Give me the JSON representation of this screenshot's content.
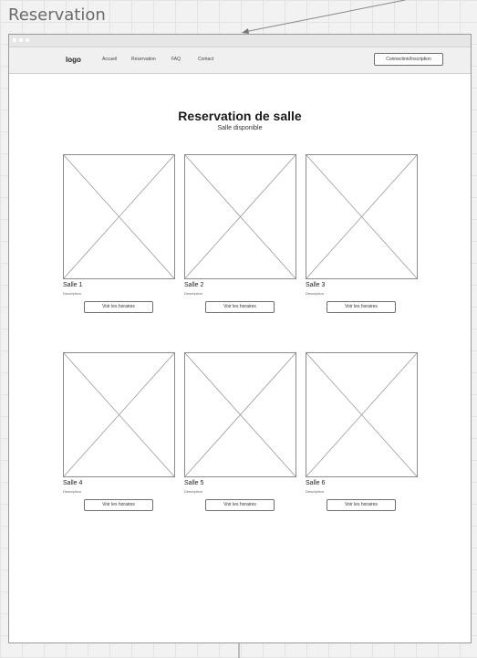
{
  "frame": {
    "title": "Reservation"
  },
  "navbar": {
    "logo": "logo",
    "links": [
      "Accueil",
      "Reservation",
      "FAQ",
      "Contact"
    ],
    "login_button": "Connection/Inscription"
  },
  "main": {
    "title": "Reservation de salle",
    "subtitle": "Salle disponible"
  },
  "rooms": [
    {
      "name": "Salle 1",
      "description": "Description",
      "button": "Voir les horaires"
    },
    {
      "name": "Salle 2",
      "description": "Description",
      "button": "Voir les horaires"
    },
    {
      "name": "Salle 3",
      "description": "Description",
      "button": "Voir les horaires"
    },
    {
      "name": "Salle 4",
      "description": "Description",
      "button": "Voir les horaires"
    },
    {
      "name": "Salle 5",
      "description": "Description",
      "button": "Voir les horaires"
    },
    {
      "name": "Salle 6",
      "description": "Description",
      "button": "Voir les horaires"
    }
  ]
}
